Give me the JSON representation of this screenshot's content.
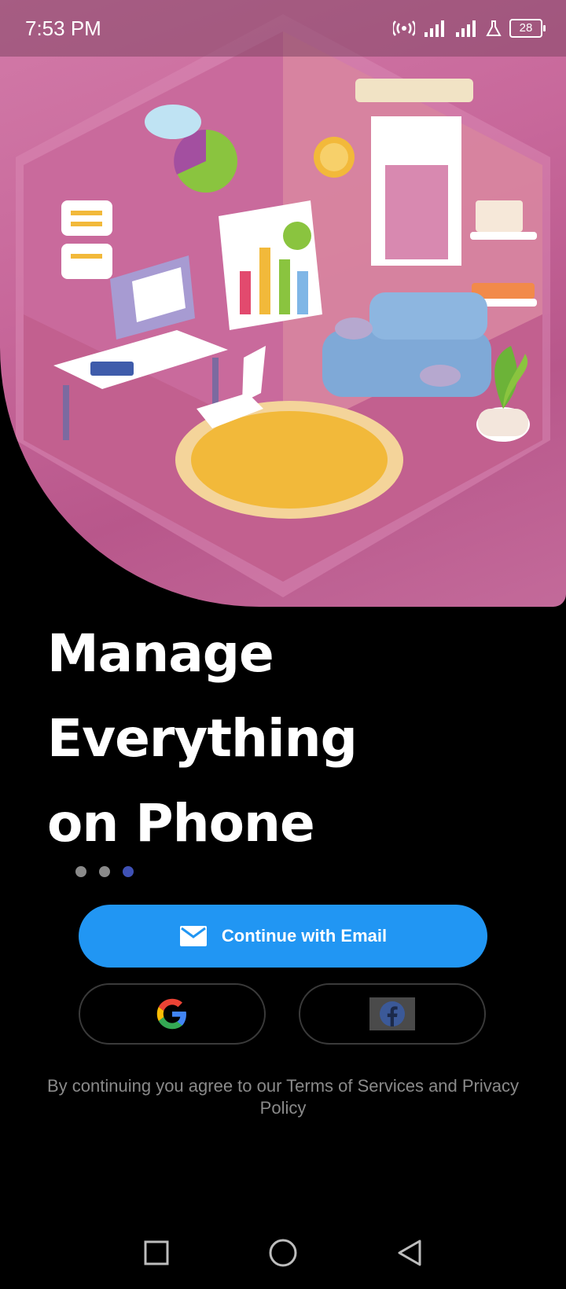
{
  "status_bar": {
    "time": "7:53 PM",
    "battery": "28"
  },
  "hero": {
    "illustration": "isometric-pink-home-office-room"
  },
  "onboarding": {
    "headline_lines": [
      "Manage",
      "Everything",
      "on Phone"
    ],
    "page_indicator": {
      "total": 3,
      "active_index": 2
    }
  },
  "auth": {
    "email_button_label": "Continue with Email",
    "google_icon": "google-icon",
    "facebook_icon": "facebook-icon",
    "terms_text": "By continuing you agree to our Terms of Services and Privacy Policy"
  },
  "colors": {
    "primary": "#2196f3",
    "active_dot": "#3f51b5",
    "inactive_dot": "#8a8a8a",
    "hero_pink": "#c7679a"
  }
}
